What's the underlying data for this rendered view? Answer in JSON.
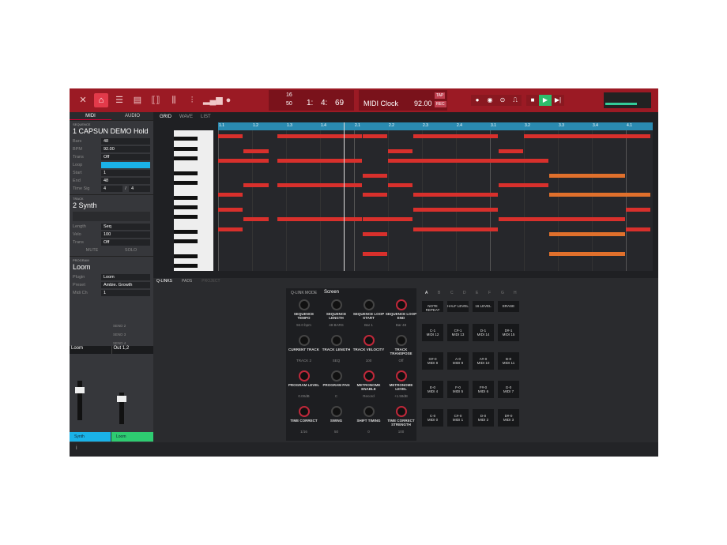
{
  "toolbar": {
    "icons": [
      "menu-icon",
      "home-icon",
      "browser-icon",
      "sampler-icon",
      "q-link-icon",
      "pad-mixer-icon",
      "channel-mixer-icon",
      "level-meter-icon",
      "settings-icon"
    ],
    "bars_value": "16",
    "tempo_small": "50",
    "position": [
      "1:",
      "4:",
      "69"
    ],
    "sync_label": "MIDI Clock",
    "bpm": "92.00",
    "tap": "TAP",
    "rec": "REC",
    "transport": [
      "record-icon",
      "overdub-icon",
      "automation-icon",
      "rec-mode-icon",
      "stop-icon",
      "play-icon",
      "play-start-icon"
    ]
  },
  "left": {
    "tabs": [
      "MIDI",
      "AUDIO"
    ],
    "sequence": {
      "header": "SEQUENCE",
      "name": "1 CAPSUN DEMO Hold",
      "rows": [
        [
          "Bars",
          "48"
        ],
        [
          "BPM",
          "92.00"
        ],
        [
          "Trans",
          "Off"
        ],
        [
          "Loop",
          ""
        ],
        [
          "Start",
          "1"
        ],
        [
          "End",
          "48"
        ]
      ],
      "timesig_label": "Time Sig",
      "timesig": [
        "4",
        "4"
      ]
    },
    "track": {
      "header": "TRACK",
      "name": "2 Synth",
      "rows": [
        [
          "Length",
          "Seq"
        ],
        [
          "Velo",
          "100"
        ],
        [
          "Trans",
          "Off"
        ]
      ],
      "mute": "MUTE",
      "solo": "SOLO"
    },
    "program": {
      "header": "PROGRAM",
      "name": "Loom",
      "rows": [
        [
          "Plugin",
          "Loom"
        ],
        [
          "Preset",
          "Ambie. Growth"
        ],
        [
          "Midi Ch",
          "1"
        ]
      ]
    },
    "sends": [
      "SEND 2",
      "SEND 3",
      "SEND 4"
    ],
    "mixer": {
      "inputs": [
        "Loom",
        "Out 1,2"
      ],
      "channels": [
        "Synth",
        "Loom"
      ],
      "channel_colors": [
        "#1ab2e8",
        "#2ecc71"
      ]
    }
  },
  "grid": {
    "tabs": [
      "GRID",
      "WAVE",
      "LIST"
    ],
    "ruler": [
      "1.1",
      "1.2",
      "1.3",
      "1.4",
      "2.1",
      "2.2",
      "2.3",
      "2.4",
      "3.1",
      "3.2",
      "3.3",
      "3.4",
      "4.1"
    ],
    "playhead_beat": 3.7,
    "notes": [
      {
        "row": 0,
        "s": 0,
        "e": 0.75
      },
      {
        "row": 0,
        "s": 1.75,
        "e": 4.25
      },
      {
        "row": 0,
        "s": 4.25,
        "e": 5
      },
      {
        "row": 0,
        "s": 5.75,
        "e": 8.25
      },
      {
        "row": 0,
        "s": 9,
        "e": 12.75
      },
      {
        "row": 3,
        "s": 0.75,
        "e": 1.5
      },
      {
        "row": 3,
        "s": 5,
        "e": 5.75
      },
      {
        "row": 3,
        "s": 8.25,
        "e": 9
      },
      {
        "row": 5,
        "s": 0,
        "e": 1.5
      },
      {
        "row": 5,
        "s": 1.75,
        "e": 4.25
      },
      {
        "row": 5,
        "s": 5,
        "e": 9.75
      },
      {
        "row": 8,
        "s": 4.25,
        "e": 5
      },
      {
        "row": 8,
        "s": 9.75,
        "e": 12,
        "sel": true
      },
      {
        "row": 10,
        "s": 0.75,
        "e": 1.5
      },
      {
        "row": 10,
        "s": 1.75,
        "e": 4.25
      },
      {
        "row": 10,
        "s": 5,
        "e": 5.75
      },
      {
        "row": 10,
        "s": 8.25,
        "e": 9.75
      },
      {
        "row": 12,
        "s": 0,
        "e": 0.75
      },
      {
        "row": 12,
        "s": 4.25,
        "e": 5
      },
      {
        "row": 12,
        "s": 5.75,
        "e": 8.25
      },
      {
        "row": 12,
        "s": 9.75,
        "e": 12.75,
        "sel": true
      },
      {
        "row": 15,
        "s": 0,
        "e": 0.75
      },
      {
        "row": 15,
        "s": 5.75,
        "e": 8.25
      },
      {
        "row": 15,
        "s": 12,
        "e": 12.75
      },
      {
        "row": 17,
        "s": 0.75,
        "e": 1.5
      },
      {
        "row": 17,
        "s": 1.75,
        "e": 4.25
      },
      {
        "row": 17,
        "s": 4.25,
        "e": 5.75
      },
      {
        "row": 17,
        "s": 8.25,
        "e": 12
      },
      {
        "row": 19,
        "s": 0,
        "e": 0.75
      },
      {
        "row": 19,
        "s": 5.75,
        "e": 8.25
      },
      {
        "row": 19,
        "s": 12,
        "e": 12.75
      },
      {
        "row": 20,
        "s": 4.25,
        "e": 5
      },
      {
        "row": 20,
        "s": 9.75,
        "e": 12,
        "sel": true
      },
      {
        "row": 24,
        "s": 4.25,
        "e": 5
      },
      {
        "row": 24,
        "s": 9.75,
        "e": 12,
        "sel": true
      }
    ]
  },
  "bottom_tabs": [
    "Q-LINKS",
    "PADS",
    "PROJECT"
  ],
  "qlink": {
    "mode_label": "Q-LINK MODE",
    "mode": "Screen",
    "knobs": [
      {
        "n": "SEQUENCE TEMPO",
        "v": "92.0 bpm"
      },
      {
        "n": "SEQUENCE LENGTH",
        "v": "48 BARS"
      },
      {
        "n": "SEQUENCE LOOP START",
        "v": "Bar 1"
      },
      {
        "n": "SEQUENCE LOOP END",
        "v": "Bar 48",
        "red": true
      },
      {
        "n": "CURRENT TRACK",
        "v": "TRACK 2"
      },
      {
        "n": "TRACK LENGTH",
        "v": "SEQ"
      },
      {
        "n": "TRACK VELOCITY",
        "v": "100",
        "red": true
      },
      {
        "n": "TRACK TRANSPOSE",
        "v": "Off"
      },
      {
        "n": "PROGRAM LEVEL",
        "v": "0.00dB",
        "red": true
      },
      {
        "n": "PROGRAM PAN",
        "v": "C"
      },
      {
        "n": "METRONOME ENABLE",
        "v": "Record",
        "red": true
      },
      {
        "n": "METRONOME LEVEL",
        "v": "+1.58dB",
        "red": true
      },
      {
        "n": "TIME CORRECT",
        "v": "1/16",
        "red": true
      },
      {
        "n": "SWING",
        "v": "50"
      },
      {
        "n": "SHIFT TIMING",
        "v": "0"
      },
      {
        "n": "TIME CORRECT STRENGTH",
        "v": "100",
        "red": true
      }
    ]
  },
  "pads": {
    "banks": [
      "A",
      "B",
      "C",
      "D",
      "E",
      "F",
      "G",
      "H"
    ],
    "buttons": [
      "NOTE REPEAT",
      "HALF LEVEL",
      "16 LEVEL",
      "ERASE"
    ],
    "grid": [
      [
        "C-1",
        "MIDI 12"
      ],
      [
        "C#-1",
        "MIDI 13"
      ],
      [
        "D-1",
        "MIDI 14"
      ],
      [
        "D#-1",
        "MIDI 15"
      ],
      [
        "G#-0",
        "MIDI 8"
      ],
      [
        "A-0",
        "MIDI 9"
      ],
      [
        "A#-0",
        "MIDI 10"
      ],
      [
        "B-0",
        "MIDI 11"
      ],
      [
        "E-0",
        "MIDI 4"
      ],
      [
        "F-0",
        "MIDI 5"
      ],
      [
        "F#-0",
        "MIDI 6"
      ],
      [
        "G-0",
        "MIDI 7"
      ],
      [
        "C-0",
        "MIDI 0"
      ],
      [
        "C#-0",
        "MIDI 1"
      ],
      [
        "D-0",
        "MIDI 2"
      ],
      [
        "D#-0",
        "MIDI 3"
      ]
    ]
  }
}
